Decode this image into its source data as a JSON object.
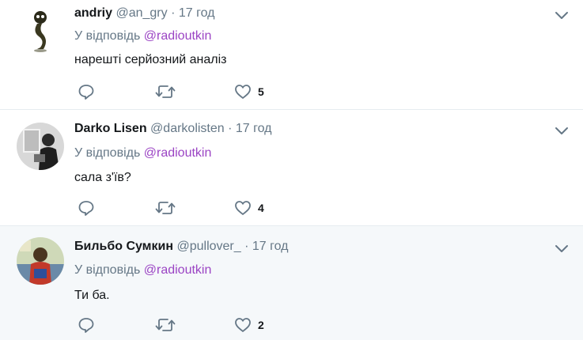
{
  "tweets": [
    {
      "name": "andriy",
      "handle": "@an_gry",
      "dot": "·",
      "time": "17 год",
      "reply_prefix": "У відповідь",
      "reply_to": "@radioutkin",
      "text": "нарешті серйозний аналіз",
      "likes": "5",
      "avatar_icon": "cartoon-figure-avatar"
    },
    {
      "name": "Darko Lisen",
      "handle": "@darkolisten",
      "dot": "·",
      "time": "17 год",
      "reply_prefix": "У відповідь",
      "reply_to": "@radioutkin",
      "text": "сала з'їв?",
      "likes": "4",
      "avatar_icon": "grayscale-photo-avatar"
    },
    {
      "name": "Бильбо Сумкин",
      "handle": "@pullover_",
      "dot": "·",
      "time": "17 год",
      "reply_prefix": "У відповідь",
      "reply_to": "@radioutkin",
      "text": "Ти ба.",
      "likes": "2",
      "avatar_icon": "color-photo-avatar"
    }
  ],
  "colors": {
    "mention": "#9b44c4",
    "muted": "#657786",
    "text": "#14171a",
    "highlight_bg": "#f5f8fa",
    "divider": "#e6ecf0"
  }
}
